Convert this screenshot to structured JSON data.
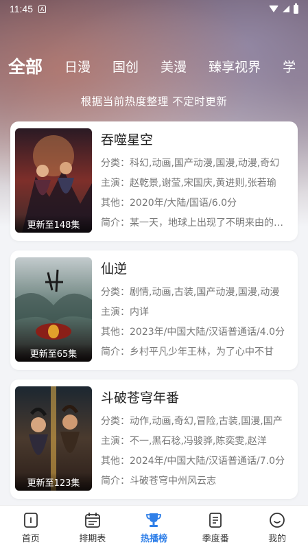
{
  "status_bar": {
    "time": "11:45",
    "notification_glyph": "A"
  },
  "tabs": [
    {
      "label": "全部",
      "active": true
    },
    {
      "label": "日漫",
      "active": false
    },
    {
      "label": "国创",
      "active": false
    },
    {
      "label": "美漫",
      "active": false
    },
    {
      "label": "臻享视界",
      "active": false
    },
    {
      "label": "学",
      "active": false
    }
  ],
  "subtitle": "根据当前热度整理 不定时更新",
  "cards": [
    {
      "title": "吞噬星空",
      "badge": "更新至148集",
      "category": "分类：科幻,动画,国产动漫,国漫,动漫,奇幻",
      "cast": "主演：赵乾景,谢莹,宋国庆,黄进则,张若瑜",
      "other": "其他：2020年/大陆/国语/6.0分",
      "intro": "简介：某一天，地球上出现了不明来由的怪兽",
      "poster_colors": [
        "#3a1f2a",
        "#8b3a2f",
        "#d8a36a"
      ]
    },
    {
      "title": "仙逆",
      "badge": "更新至65集",
      "category": "分类：剧情,动画,古装,国产动漫,国漫,动漫",
      "cast": "主演：内详",
      "other": "其他：2023年/中国大陆/汉语普通话/4.0分",
      "intro": "简介：乡村平凡少年王林，为了心中不甘",
      "poster_colors": [
        "#b9c3c5",
        "#4b6a63",
        "#7a1d18"
      ]
    },
    {
      "title": "斗破苍穹年番",
      "badge": "更新至123集",
      "category": "分类：动作,动画,奇幻,冒险,古装,国漫,国产",
      "cast": "主演：不一,黑石稔,冯骏骅,陈奕雯,赵洋",
      "other": "其他：2024年/中国大陆/汉语普通话/7.0分",
      "intro": "简介：斗破苍穹中州风云志",
      "poster_colors": [
        "#1e2a34",
        "#c9882e",
        "#3b2a22"
      ]
    }
  ],
  "bottom_nav": [
    {
      "label": "首页",
      "icon": "home-icon",
      "active": false
    },
    {
      "label": "排期表",
      "icon": "calendar-icon",
      "active": false
    },
    {
      "label": "热播榜",
      "icon": "trophy-icon",
      "active": true
    },
    {
      "label": "季度番",
      "icon": "document-icon",
      "active": false
    },
    {
      "label": "我的",
      "icon": "smiley-icon",
      "active": false
    }
  ],
  "colors": {
    "accent": "#2f7fe8",
    "background": "#f3f4f7"
  }
}
